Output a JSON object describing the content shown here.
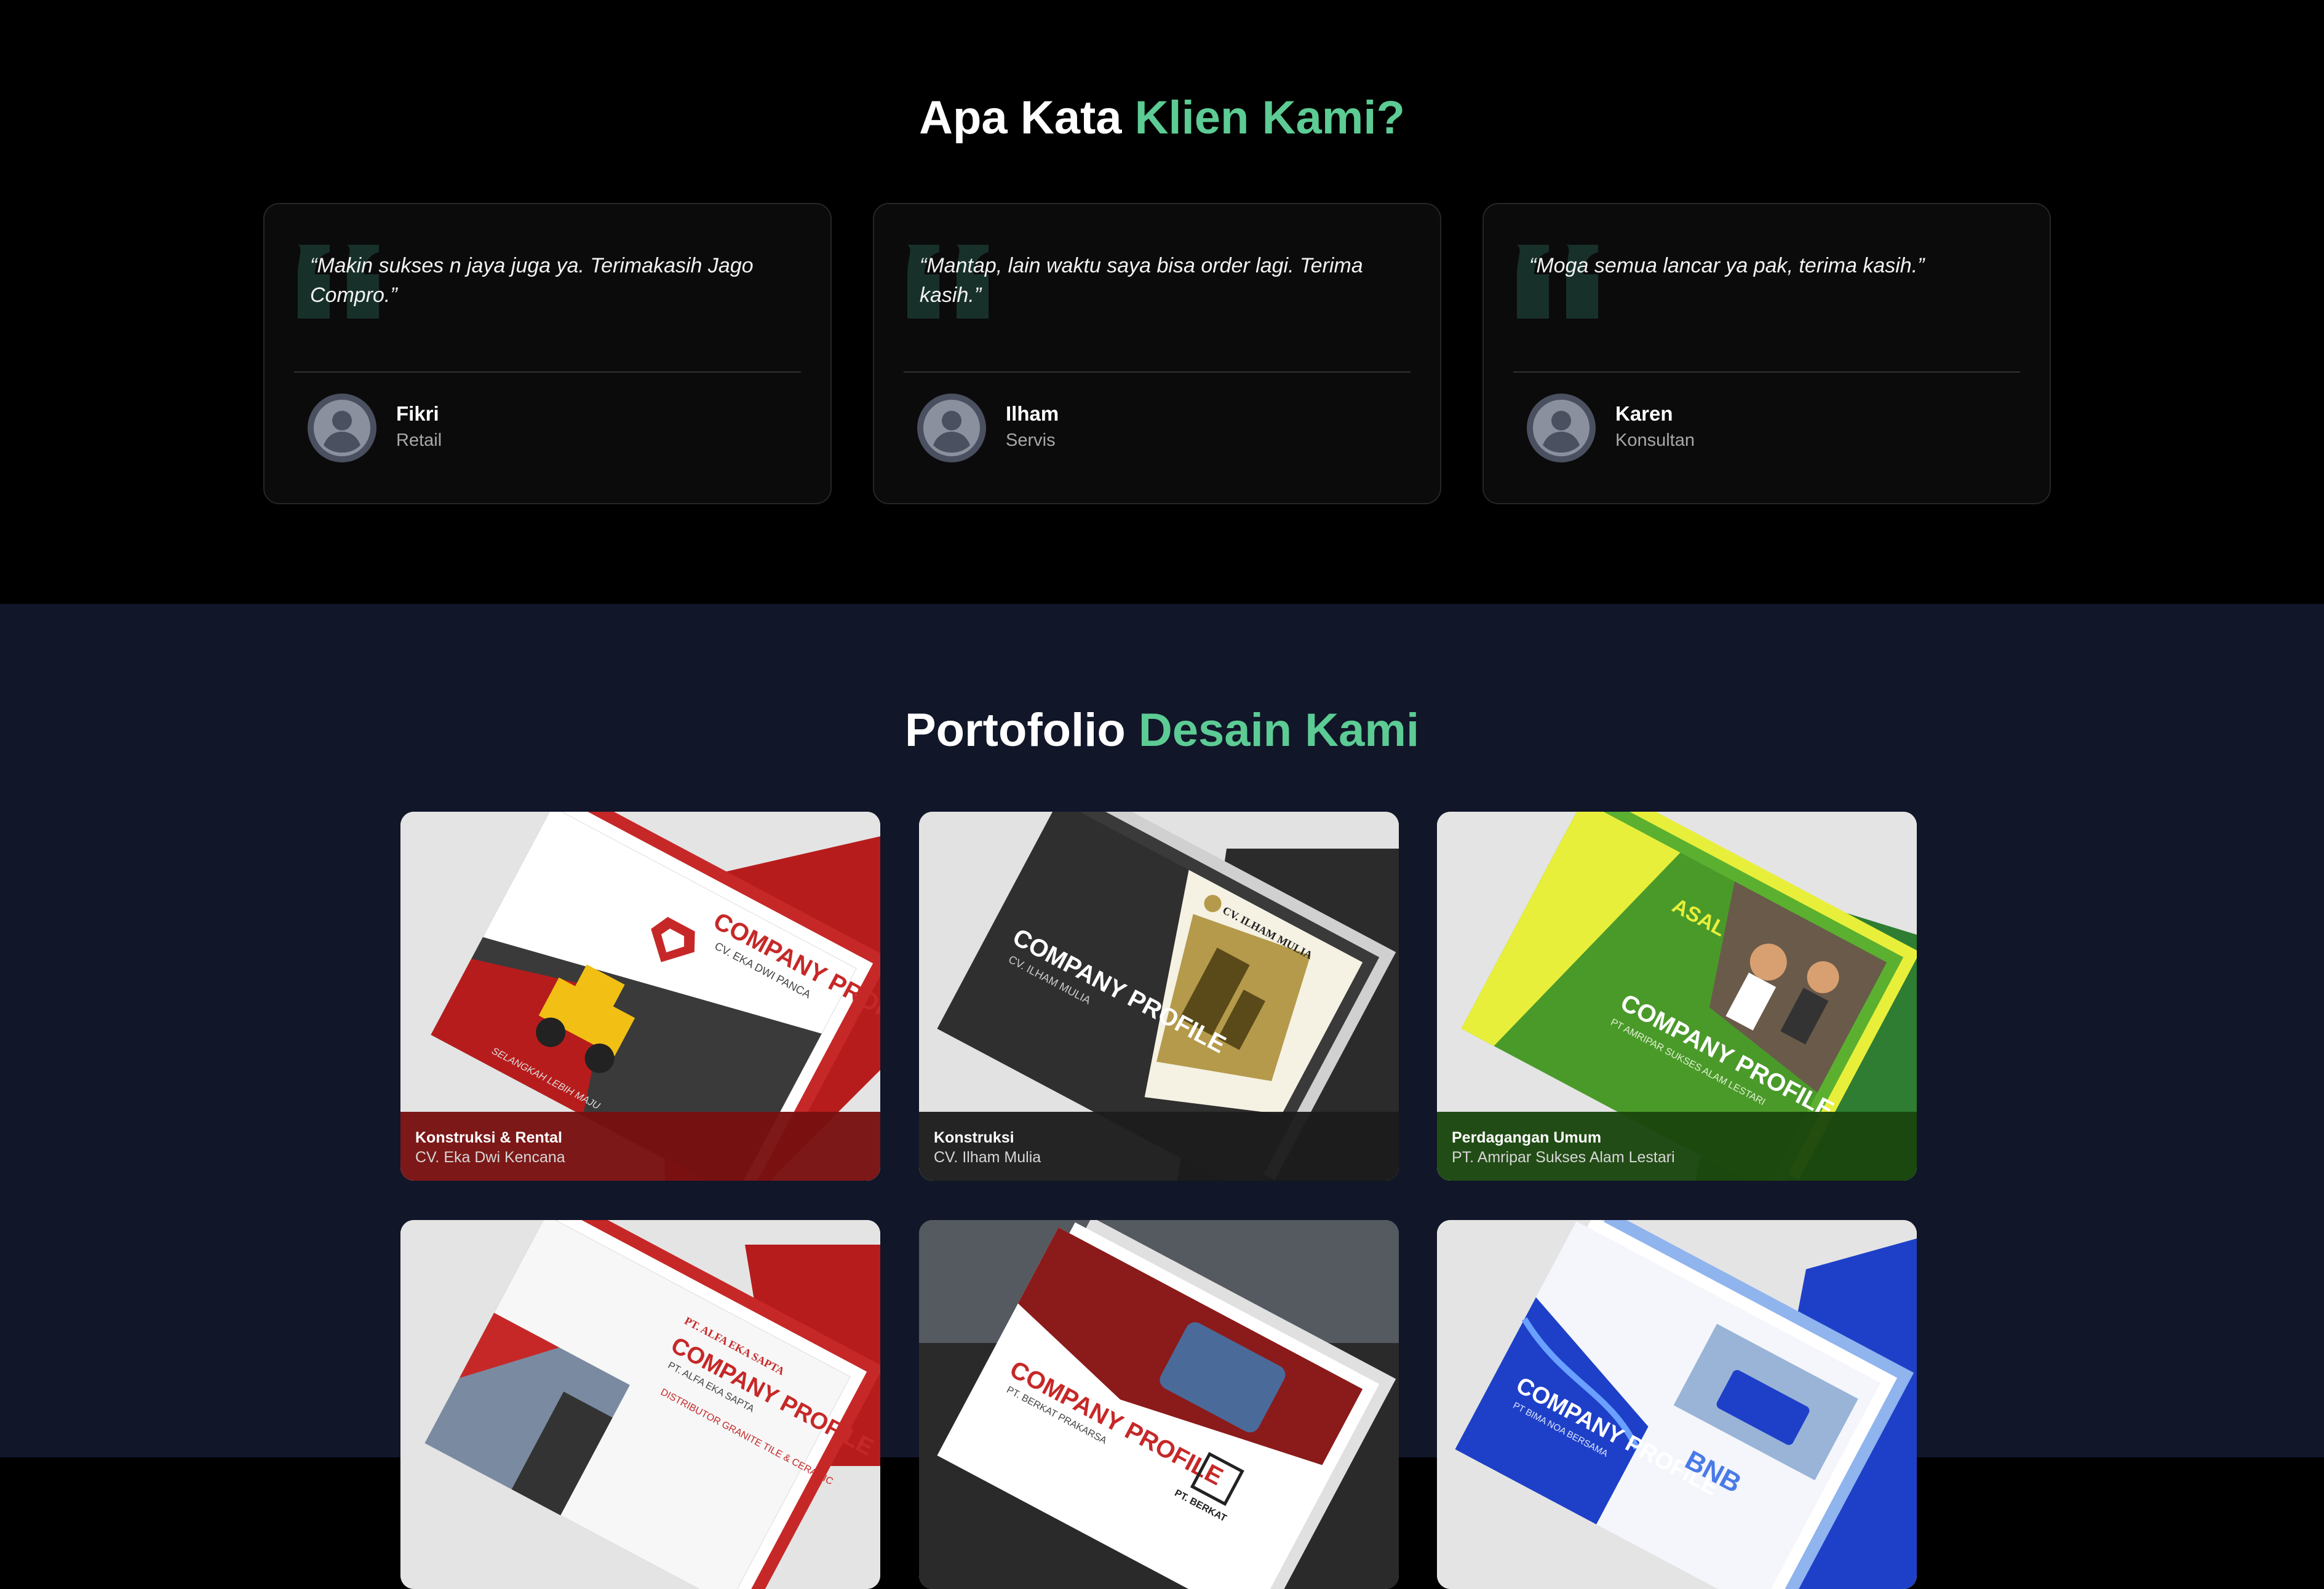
{
  "testimonials": {
    "title_main": "Apa Kata ",
    "title_accent": "Klien Kami?",
    "items": [
      {
        "quote": "“Makin sukses n jaya juga ya. Terimakasih Jago Compro.”",
        "name": "Fikri",
        "role": "Retail"
      },
      {
        "quote": "“Mantap, lain waktu saya bisa order lagi. Terima kasih.”",
        "name": "Ilham",
        "role": "Servis"
      },
      {
        "quote": "“Moga semua lancar ya pak, terima kasih.”",
        "name": "Karen",
        "role": "Konsultan"
      }
    ]
  },
  "portfolio": {
    "title_main": "Portofolio ",
    "title_accent": "Desain Kami",
    "items": [
      {
        "category": "Konstruksi & Rental",
        "client": "CV. Eka Dwi Kencana",
        "cover_title": "COMPANY PROFILE",
        "cover_sub": "CV. EKA DWI PANCA",
        "tagline": "SELANGKAH LEBIH MAJU",
        "theme": "red"
      },
      {
        "category": "Konstruksi",
        "client": "CV. Ilham Mulia",
        "cover_title": "COMPANY PROFILE",
        "cover_sub": "CV. ILHAM MULIA",
        "brand": "CV. ILHAM MULIA",
        "theme": "dark"
      },
      {
        "category": "Perdagangan Umum",
        "client": "PT. Amripar Sukses Alam Lestari",
        "cover_title": "COMPANY PROFILE",
        "cover_sub": "PT AMRIPAR SUKSES ALAM LESTARI",
        "brand": "ASAL",
        "theme": "green"
      },
      {
        "category": "",
        "client": "",
        "cover_title": "COMPANY PROFILE",
        "cover_sub": "PT. ALFA EKA SAPTA",
        "brand": "PT. ALFA EKA SAPTA",
        "tagline": "DISTRIBUTOR GRANITE TILE & CERAMIC",
        "theme": "red-light"
      },
      {
        "category": "",
        "client": "",
        "cover_title": "COMPANY PROFILE",
        "cover_sub": "PT. BERKAT PRAKARSA",
        "brand": "PT. BERKAT",
        "theme": "red-dark"
      },
      {
        "category": "",
        "client": "",
        "cover_title": "COMPANY PROFILE",
        "cover_sub": "PT BIMA NOA BERSAMA",
        "brand": "BNB",
        "theme": "blue"
      }
    ]
  },
  "colors": {
    "accent": "#5ccb94",
    "testimonials_bg": "#000000",
    "portfolio_bg": "#111629"
  }
}
